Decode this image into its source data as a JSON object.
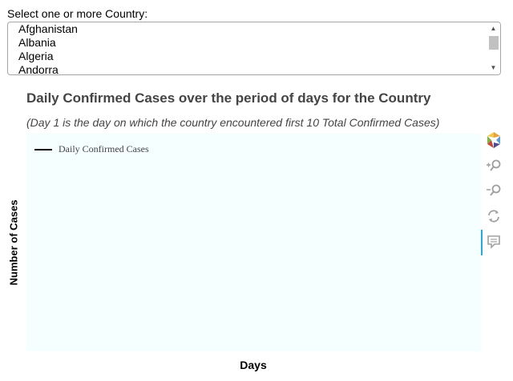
{
  "selector": {
    "label": "Select one or more Country:",
    "options": [
      "Afghanistan",
      "Albania",
      "Algeria",
      "Andorra"
    ]
  },
  "chart_data": {
    "type": "line",
    "title": "Daily Confirmed Cases over the period of days for the Country",
    "subtitle": "(Day 1 is the day on which the country encountered first 10 Total Confirmed Cases)",
    "xlabel": "Days",
    "ylabel": "Number of Cases",
    "legend_position": "top-left",
    "series": [
      {
        "name": "Daily Confirmed Cases",
        "x": [],
        "y": []
      }
    ],
    "grid": false,
    "background": "#f5ffff"
  },
  "toolbar": {
    "tools": [
      "bokeh-logo-icon",
      "zoom-in-icon",
      "zoom-out-icon",
      "reset-icon",
      "hover-tooltip-icon"
    ],
    "active_tool": "hover-tooltip-icon"
  }
}
